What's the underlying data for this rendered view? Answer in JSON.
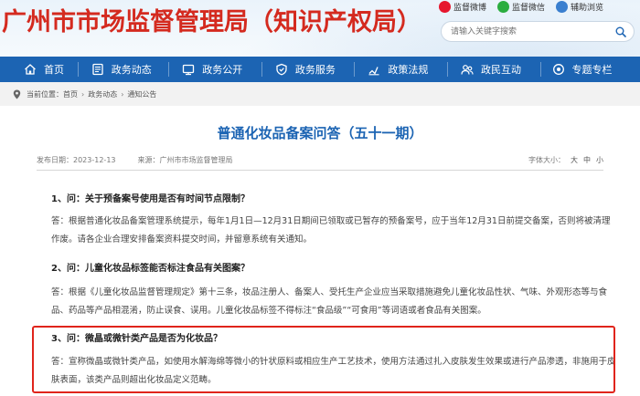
{
  "header": {
    "site_title": "广州市市场监督管理局（知识产权局）",
    "social": [
      {
        "label": "监督微博",
        "icon": "weibo-icon",
        "color": "#e6162d"
      },
      {
        "label": "监督微信",
        "icon": "wechat-icon",
        "color": "#2bad3f"
      },
      {
        "label": "辅助浏览",
        "icon": "accessibility-icon",
        "color": "#3a7fcf"
      }
    ],
    "search_placeholder": "请输入关键字搜索"
  },
  "nav": {
    "items": [
      {
        "label": "首页",
        "icon": "home-icon"
      },
      {
        "label": "政务动态",
        "icon": "news-icon"
      },
      {
        "label": "政务公开",
        "icon": "public-icon"
      },
      {
        "label": "政务服务",
        "icon": "shield-icon"
      },
      {
        "label": "政策法规",
        "icon": "policy-icon"
      },
      {
        "label": "政民互动",
        "icon": "interaction-icon"
      },
      {
        "label": "专题专栏",
        "icon": "topic-icon"
      }
    ],
    "bg_color": "#1c64b3"
  },
  "breadcrumb": {
    "prefix": "当前位置：",
    "items": [
      "首页",
      "政务动态",
      "通知公告"
    ]
  },
  "article": {
    "title": "普通化妆品备案问答（五十一期）",
    "publish_label": "发布日期：",
    "publish_date": "2023-12-13",
    "source_label": "来源：",
    "source": "广州市市场监督管理局",
    "font_size_label": "字体大小：",
    "font_sizes": [
      "大",
      "中",
      "小"
    ],
    "qa": [
      {
        "q": "1、问：关于预备案号使用是否有时间节点限制？",
        "a": "答：根据普通化妆品备案管理系统提示，每年1月1日—12月31日期间已领取或已暂存的预备案号，应于当年12月31日前提交备案，否则将被清理作废。请各企业合理安排备案资料提交时间，并留意系统有关通知。"
      },
      {
        "q": "2、问：儿童化妆品标签能否标注食品有关图案？",
        "a": "答：根据《儿童化妆品监督管理规定》第十三条，妆品注册人、备案人、受托生产企业应当采取措施避免儿童化妆品性状、气味、外观形态等与食品、药品等产品相混淆，防止误食、误用。儿童化妆品标签不得标注“食品级”“可食用”等词语或者食品有关图案。"
      },
      {
        "q": "3、问：微晶或微针类产品是否为化妆品？",
        "a": "答：宣称微晶或微针类产品，如使用水解海绵等微小的针状原料或相应生产工艺技术，使用方法通过扎入皮肤发生效果或进行产品渗透，非施用于皮肤表面，该类产品则超出化妆品定义范畴。"
      }
    ]
  },
  "highlight_color": "#e0241b"
}
